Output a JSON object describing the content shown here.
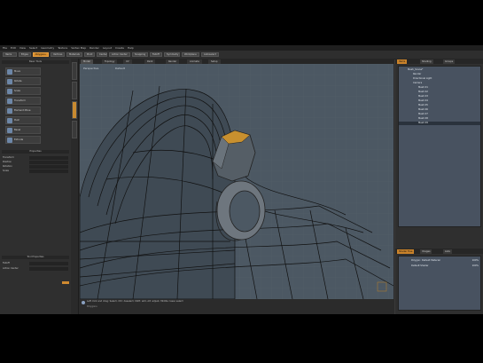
{
  "menu": [
    "File",
    "Edit",
    "View",
    "Select",
    "Geometry",
    "Texture",
    "Vertex Map",
    "Render",
    "Layout",
    "Create",
    "Help"
  ],
  "toolbar": {
    "buttons": [
      "Items",
      "Edges",
      "Polygons",
      "Vertices",
      "Materials",
      "Pivot",
      "Center",
      "Action Center",
      "Snapping",
      "Falloff",
      "Symmetry",
      "Workplane",
      "Autoselect"
    ],
    "active": "Polygons"
  },
  "left_panel": {
    "title": "Basic Tools",
    "tools": [
      "Move",
      "Rotate",
      "Scale",
      "Transform",
      "Element Move",
      "Push",
      "Bevel",
      "Extrude"
    ],
    "props_title": "Properties",
    "fields": [
      "Transform",
      "Position",
      "Rotation",
      "Scale"
    ],
    "lower_title": "Tool Properties",
    "lower_fields": [
      "Falloff",
      "Action Center"
    ]
  },
  "viewport": {
    "tabs": [
      "Model",
      "Topology",
      "UV",
      "Paint",
      "Render",
      "Animate",
      "Setup"
    ],
    "view_label": "Perspective",
    "shading_label": "Default",
    "status_text": "Left click and drag: Select, Ctrl: deselect, Shift: add, Alt: adjust, Middle: lasso select",
    "status_sub": "Polygons"
  },
  "right_panel": {
    "tabs": [
      "Items",
      "Shading",
      "Groups"
    ],
    "tree": [
      "Mesh_Scene*",
      "Render",
      "Directional Light",
      "Camera",
      "Mesh 01",
      "Mesh 02",
      "Mesh 03",
      "Mesh 04",
      "Mesh 05",
      "Mesh 06",
      "Mesh 07",
      "Mesh 08",
      "Mesh 09"
    ],
    "selected_index": 12,
    "lower_tabs": [
      "Shader Tree",
      "Images",
      "Lists"
    ],
    "shaders": [
      {
        "name": "Polygon: Default Material",
        "num": "100%"
      },
      {
        "name": "Default Shader",
        "num": "100%"
      }
    ]
  }
}
